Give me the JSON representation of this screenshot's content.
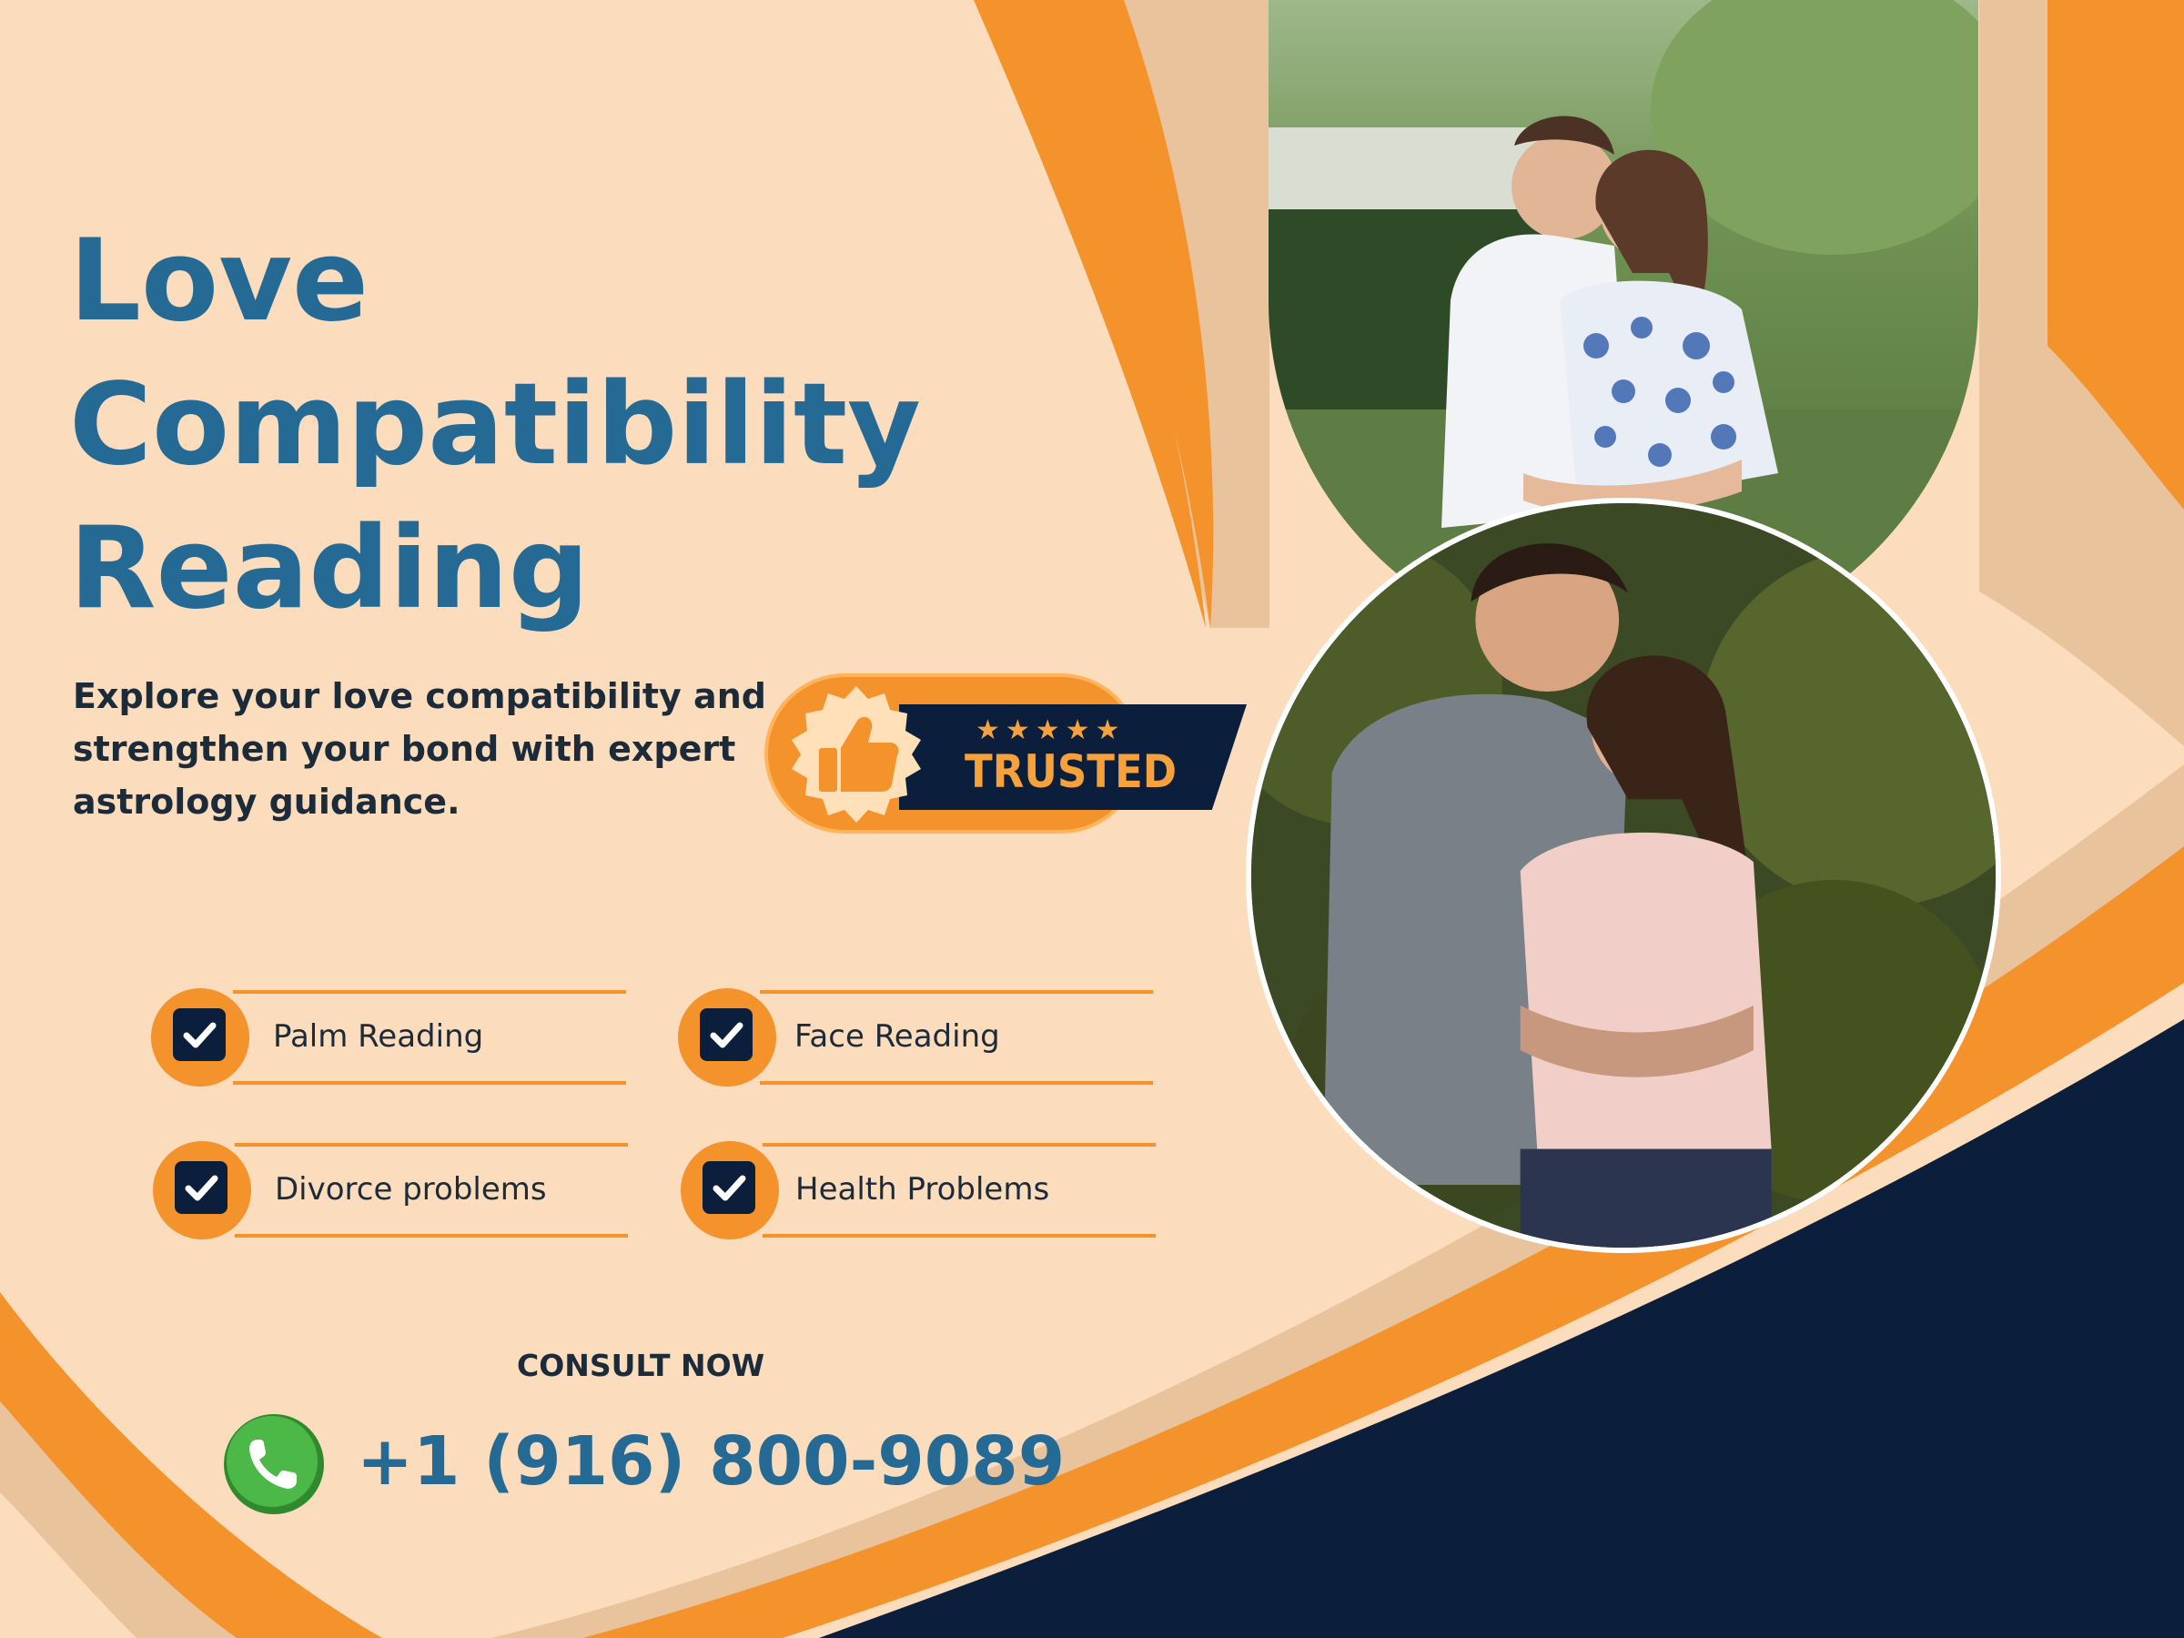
{
  "title": {
    "line1": "Love",
    "line2": "Compatibility",
    "line3": "Reading"
  },
  "subtitle": "Explore your love compatibility and strengthen your bond with expert astrology guidance.",
  "badge": {
    "stars": "★★★★★",
    "text": "TRUSTED",
    "icon": "thumbs-up-icon"
  },
  "features": [
    {
      "label": "Palm Reading",
      "icon": "checkbox-icon"
    },
    {
      "label": "Face Reading",
      "icon": "checkbox-icon"
    },
    {
      "label": "Divorce problems",
      "icon": "checkbox-icon"
    },
    {
      "label": "Health Problems",
      "icon": "checkbox-icon"
    }
  ],
  "consult": {
    "label": "CONSULT NOW",
    "phone": "+1 (916) 800-9089",
    "icon": "phone-icon"
  },
  "colors": {
    "background": "#fbdcbd",
    "accent_orange": "#f4922b",
    "navy": "#0b1f3c",
    "title_blue": "#256a94",
    "text_dark": "#1c2b3a",
    "phone_green": "#3fa83a"
  }
}
